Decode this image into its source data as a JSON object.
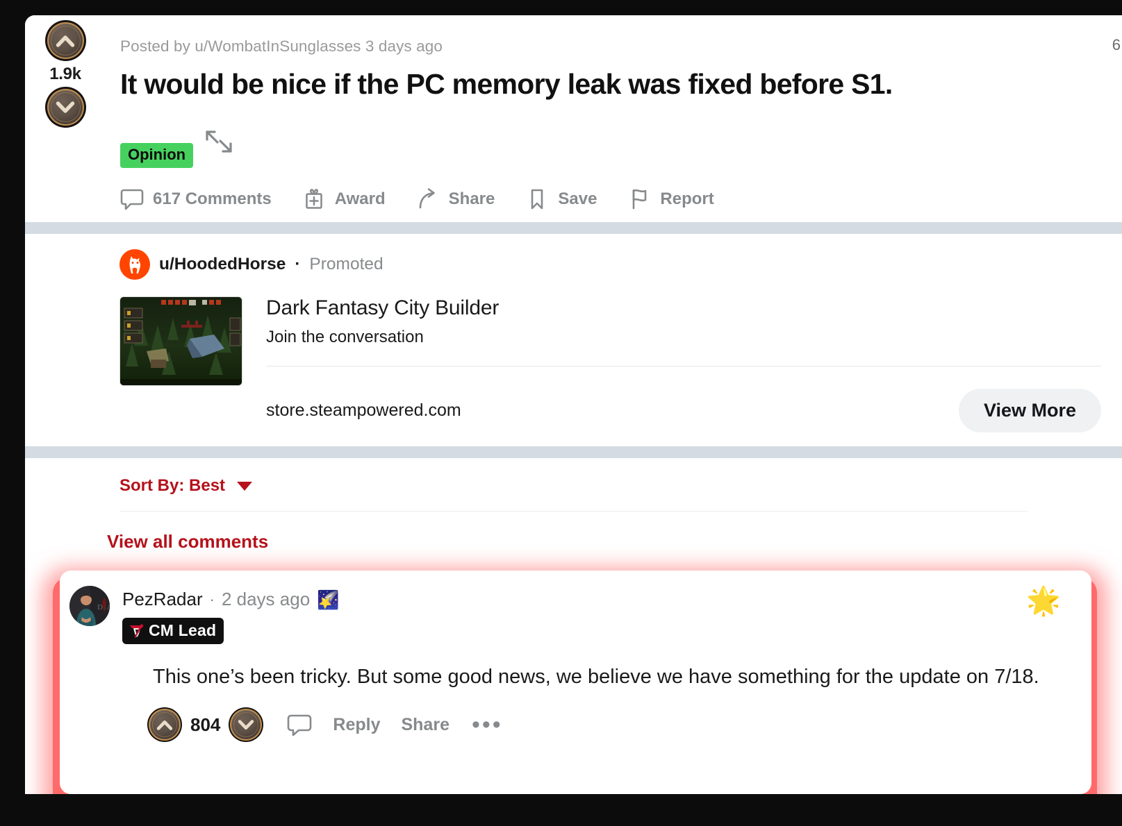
{
  "post": {
    "vote": {
      "upvote_icon": "upvote-chevron-icon",
      "downvote_icon": "downvote-chevron-icon",
      "score": "1.9k"
    },
    "byline": "Posted by u/WombatInSunglasses 3 days ago",
    "title": "It would be nice if the PC memory leak was fixed before S1.",
    "flair": "Opinion",
    "flair_color": "#46d15f",
    "expand_icon": "expand-arrows-icon",
    "actions": [
      {
        "label": "617 Comments",
        "icon": "comment-bubble-icon"
      },
      {
        "label": "Award",
        "icon": "gift-award-icon"
      },
      {
        "label": "Share",
        "icon": "share-arrow-icon"
      },
      {
        "label": "Save",
        "icon": "bookmark-icon"
      },
      {
        "label": "Report",
        "icon": "flag-icon"
      }
    ]
  },
  "ad": {
    "avatar_icon": "horse-head-avatar",
    "avatar_color": "#ff4500",
    "username": "u/HoodedHorse",
    "separator": "·",
    "promoted_label": "Promoted",
    "thumbnail_icon": "game-screenshot-thumbnail",
    "title": "Dark Fantasy City Builder",
    "subtitle": "Join the conversation",
    "url": "store.steampowered.com",
    "button_label": "View More"
  },
  "comments_bar": {
    "sort_label": "Sort By: Best",
    "caret_icon": "chevron-down-icon",
    "view_all_label": "View all comments",
    "accent_color": "#b5121b"
  },
  "highlighted_comment": {
    "avatar_icon": "pezradar-avatar",
    "username": "PezRadar",
    "separator": "·",
    "timestamp": "2 days ago",
    "emoji": "🌠",
    "badge_text": "CM Lead",
    "badge_icon": "diablo-d-logo",
    "body": "This one’s been tricky. But some good news, we believe we have something for the update on 7/18.",
    "score": "804",
    "upvote_icon": "upvote-chevron-icon",
    "downvote_icon": "downvote-chevron-icon",
    "reply_label": "Reply",
    "share_label": "Share",
    "overflow_label": "•••",
    "reply_icon": "comment-bubble-icon",
    "corner_emoji": "🌟",
    "highlight_color": "#ff6a6a"
  },
  "edge": {
    "right_glyph": "6"
  }
}
